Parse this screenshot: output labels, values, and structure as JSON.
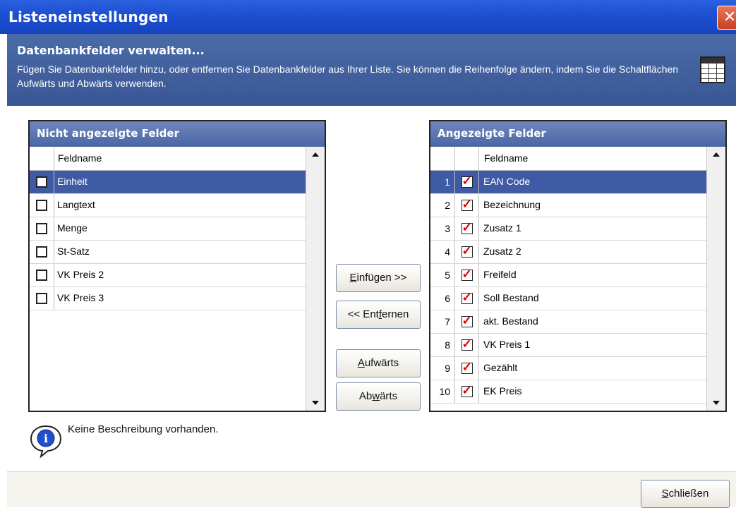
{
  "window": {
    "title": "Listeneinstellungen"
  },
  "header": {
    "title": "Datenbankfelder verwalten...",
    "description": "Fügen Sie Datenbankfelder hinzu, oder entfernen Sie Datenbankfelder aus Ihrer Liste. Sie können die Reihenfolge ändern, indem Sie die Schaltflächen Aufwärts und Abwärts verwenden.",
    "icon": "table-icon"
  },
  "left_panel": {
    "title": "Nicht angezeigte Felder",
    "column": "Feldname",
    "rows": [
      {
        "name": "Einheit",
        "checked": false,
        "selected": true
      },
      {
        "name": "Langtext",
        "checked": false,
        "selected": false
      },
      {
        "name": "Menge",
        "checked": false,
        "selected": false
      },
      {
        "name": "St-Satz",
        "checked": false,
        "selected": false
      },
      {
        "name": "VK Preis 2",
        "checked": false,
        "selected": false
      },
      {
        "name": "VK Preis 3",
        "checked": false,
        "selected": false
      }
    ]
  },
  "right_panel": {
    "title": "Angezeigte Felder",
    "column": "Feldname",
    "rows": [
      {
        "num": "1",
        "name": "EAN Code",
        "checked": true,
        "selected": true
      },
      {
        "num": "2",
        "name": "Bezeichnung",
        "checked": true,
        "selected": false
      },
      {
        "num": "3",
        "name": "Zusatz 1",
        "checked": true,
        "selected": false
      },
      {
        "num": "4",
        "name": "Zusatz 2",
        "checked": true,
        "selected": false
      },
      {
        "num": "5",
        "name": "Freifeld",
        "checked": true,
        "selected": false
      },
      {
        "num": "6",
        "name": "Soll Bestand",
        "checked": true,
        "selected": false
      },
      {
        "num": "7",
        "name": "akt. Bestand",
        "checked": true,
        "selected": false
      },
      {
        "num": "8",
        "name": "VK Preis 1",
        "checked": true,
        "selected": false
      },
      {
        "num": "9",
        "name": "Gezählt",
        "checked": true,
        "selected": false
      },
      {
        "num": "10",
        "name": "EK Preis",
        "checked": true,
        "selected": false
      }
    ]
  },
  "buttons": {
    "insert": {
      "mnemonic": "E",
      "rest": "infügen >>"
    },
    "remove": {
      "pre": "<< Ent",
      "mnemonic": "f",
      "rest": "ernen"
    },
    "up": {
      "mnemonic": "A",
      "rest": "ufwärts"
    },
    "down": {
      "pre": "Ab",
      "mnemonic": "w",
      "rest": "ärts"
    },
    "close": {
      "mnemonic": "S",
      "rest": "chließen"
    }
  },
  "info": {
    "icon": "info-icon",
    "text": "Keine Beschreibung vorhanden."
  },
  "colors": {
    "titlebar": "#1c4fd1",
    "header": "#4a6aa8",
    "selection": "#3f5ba6",
    "checkmark": "#e00000"
  }
}
